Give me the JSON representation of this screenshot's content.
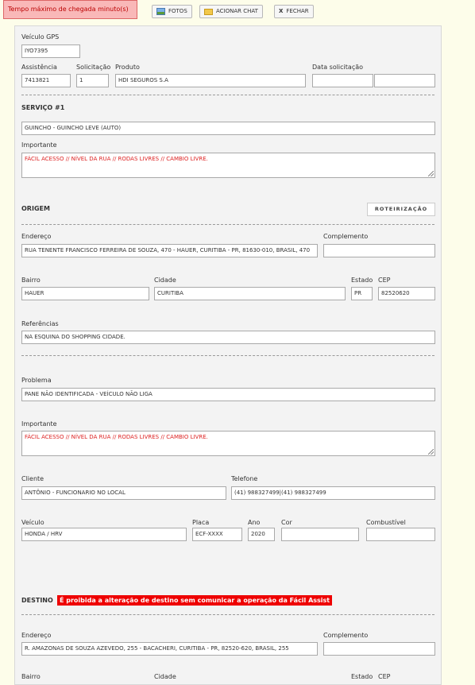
{
  "toolbar": {
    "max_time_label": "Tempo máximo de chegada minuto(s)",
    "fotos": "FOTOS",
    "chat": "ACIONAR CHAT",
    "close": "FECHAR",
    "close_icon": "X"
  },
  "header": {
    "veiculo_gps_label": "Veículo GPS",
    "veiculo_gps_value": "IYO7395",
    "assistencia_label": "Assistência",
    "assistencia_value": "7413821",
    "solicitacao_label": "Solicitação",
    "solicitacao_value": "1",
    "produto_label": "Produto",
    "produto_value": "HDI SEGUROS S.A",
    "data_label": "Data solicitação",
    "data_value1": "",
    "data_value2": ""
  },
  "servico": {
    "title": "SERVIÇO #1",
    "servico_value": "GUINCHO - GUINCHO LEVE (AUTO)",
    "importante_label": "Importante",
    "importante_value": "FÁCIL ACESSO  // NÍVEL DA RUA // RODAS LIVRES // CAMBIO LIVRE."
  },
  "origem": {
    "title": "ORIGEM",
    "roteirizacao": "ROTEIRIZAÇÃO",
    "endereco_label": "Endereço",
    "endereco_value": "RUA TENENTE FRANCISCO FERREIRA DE SOUZA, 470 - HAUER, CURITIBA - PR, 81630-010, BRASIL, 470",
    "complemento_label": "Complemento",
    "complemento_value": "",
    "bairro_label": "Bairro",
    "bairro_value": "HAUER",
    "cidade_label": "Cidade",
    "cidade_value": "CURITIBA",
    "estado_label": "Estado",
    "estado_value": "PR",
    "cep_label": "CEP",
    "cep_value": "82520620",
    "referencias_label": "Referências",
    "referencias_value": "NA ESQUINA DO SHOPPING CIDADE.",
    "problema_label": "Problema",
    "problema_value": "PANE NÃO IDENTIFICADA - VEÍCULO NÃO LIGA",
    "importante_label": "Importante",
    "importante_value": "FÁCIL ACESSO  // NÍVEL DA RUA // RODAS LIVRES // CAMBIO LIVRE.",
    "cliente_label": "Cliente",
    "cliente_value": "ANTÔNIO - FUNCIONARIO NO LOCAL",
    "telefone_label": "Telefone",
    "telefone_value": "(41) 988327499|(41) 988327499",
    "veiculo_label": "Veículo",
    "veiculo_value": "HONDA / HRV",
    "placa_label": "Placa",
    "placa_value": "ECF-XXXX",
    "ano_label": "Ano",
    "ano_value": "2020",
    "cor_label": "Cor",
    "cor_value": "",
    "combustivel_label": "Combustível",
    "combustivel_value": ""
  },
  "destino": {
    "title": "DESTINO",
    "warning": "É proibida a alteração de destino sem comunicar a operação da Fácil Assist",
    "endereco_label": "Endereço",
    "endereco_value": "R. AMAZONAS DE SOUZA AZEVEDO, 255 - BACACHERI, CURITIBA - PR, 82520-620, BRASIL, 255",
    "complemento_label": "Complemento",
    "complemento_value": "",
    "bairro_label": "Bairro",
    "cidade_label": "Cidade",
    "estado_label": "Estado",
    "cep_label": "CEP"
  },
  "colors": {
    "warning_bg": "#f9b8b8",
    "important_text": "#dd2222",
    "banner_bg": "#ee0000",
    "panel_bg": "#f3f3f3",
    "page_bg": "#fdfdea"
  }
}
